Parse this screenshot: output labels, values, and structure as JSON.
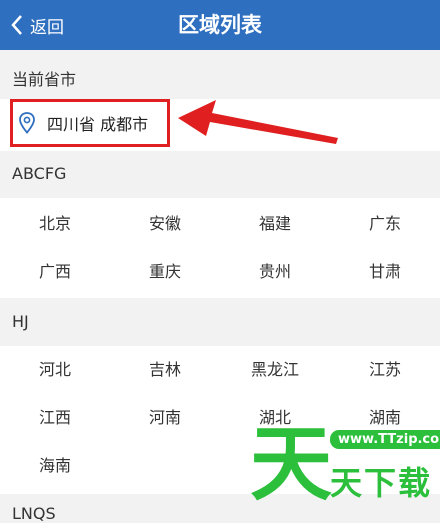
{
  "header": {
    "back_label": "返回",
    "title": "区域列表"
  },
  "current": {
    "label": "当前省市",
    "location": "四川省 成都市"
  },
  "groups": [
    {
      "label": "ABCFG",
      "cities": [
        "北京",
        "安徽",
        "福建",
        "广东",
        "广西",
        "重庆",
        "贵州",
        "甘肃"
      ]
    },
    {
      "label": "HJ",
      "cities": [
        "河北",
        "吉林",
        "黑龙江",
        "江苏",
        "江西",
        "河南",
        "湖北",
        "湖南",
        "海南"
      ]
    },
    {
      "label": "LNQS"
    }
  ],
  "watermark": {
    "url": "www.TTzip.com",
    "big": "天",
    "text": "天下载"
  },
  "colors": {
    "header_bg": "#2f6fc0",
    "highlight": "#e02020",
    "watermark": "#2bbf3b"
  }
}
